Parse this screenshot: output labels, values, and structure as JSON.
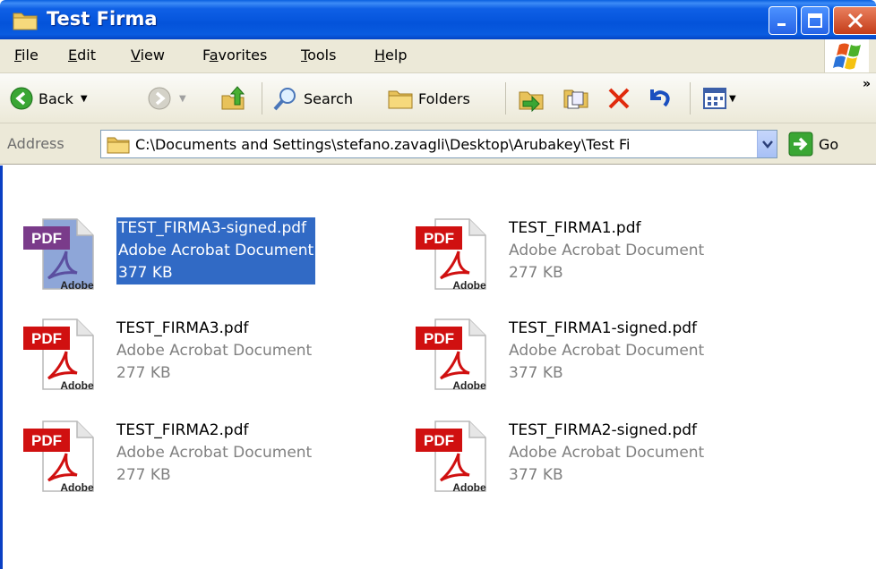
{
  "window": {
    "title": "Test Firma"
  },
  "menu": [
    "File",
    "Edit",
    "View",
    "Favorites",
    "Tools",
    "Help"
  ],
  "menu_underline": [
    "F",
    "E",
    "V",
    "a",
    "T",
    "H"
  ],
  "toolbar": {
    "back_label": "Back",
    "search_label": "Search",
    "folders_label": "Folders"
  },
  "address": {
    "label": "Address",
    "path": "C:\\Documents and Settings\\stefano.zavagli\\Desktop\\Arubakey\\Test Fi",
    "go_label": "Go"
  },
  "files": [
    {
      "name": "TEST_FIRMA3-signed.pdf",
      "type": "Adobe Acrobat Document",
      "size": "377 KB",
      "selected": true
    },
    {
      "name": "TEST_FIRMA1.pdf",
      "type": "Adobe Acrobat Document",
      "size": "277 KB",
      "selected": false
    },
    {
      "name": "TEST_FIRMA3.pdf",
      "type": "Adobe Acrobat Document",
      "size": "277 KB",
      "selected": false
    },
    {
      "name": "TEST_FIRMA1-signed.pdf",
      "type": "Adobe Acrobat Document",
      "size": "377 KB",
      "selected": false
    },
    {
      "name": "TEST_FIRMA2.pdf",
      "type": "Adobe Acrobat Document",
      "size": "277 KB",
      "selected": false
    },
    {
      "name": "TEST_FIRMA2-signed.pdf",
      "type": "Adobe Acrobat Document",
      "size": "377 KB",
      "selected": false
    }
  ],
  "icons": {
    "pdf_badge": "PDF",
    "adobe_label": "Adobe"
  },
  "colors": {
    "titlebar": "#0453da",
    "selection": "#316ac5",
    "pdf_red": "#d01010",
    "chrome": "#ece9d8"
  }
}
